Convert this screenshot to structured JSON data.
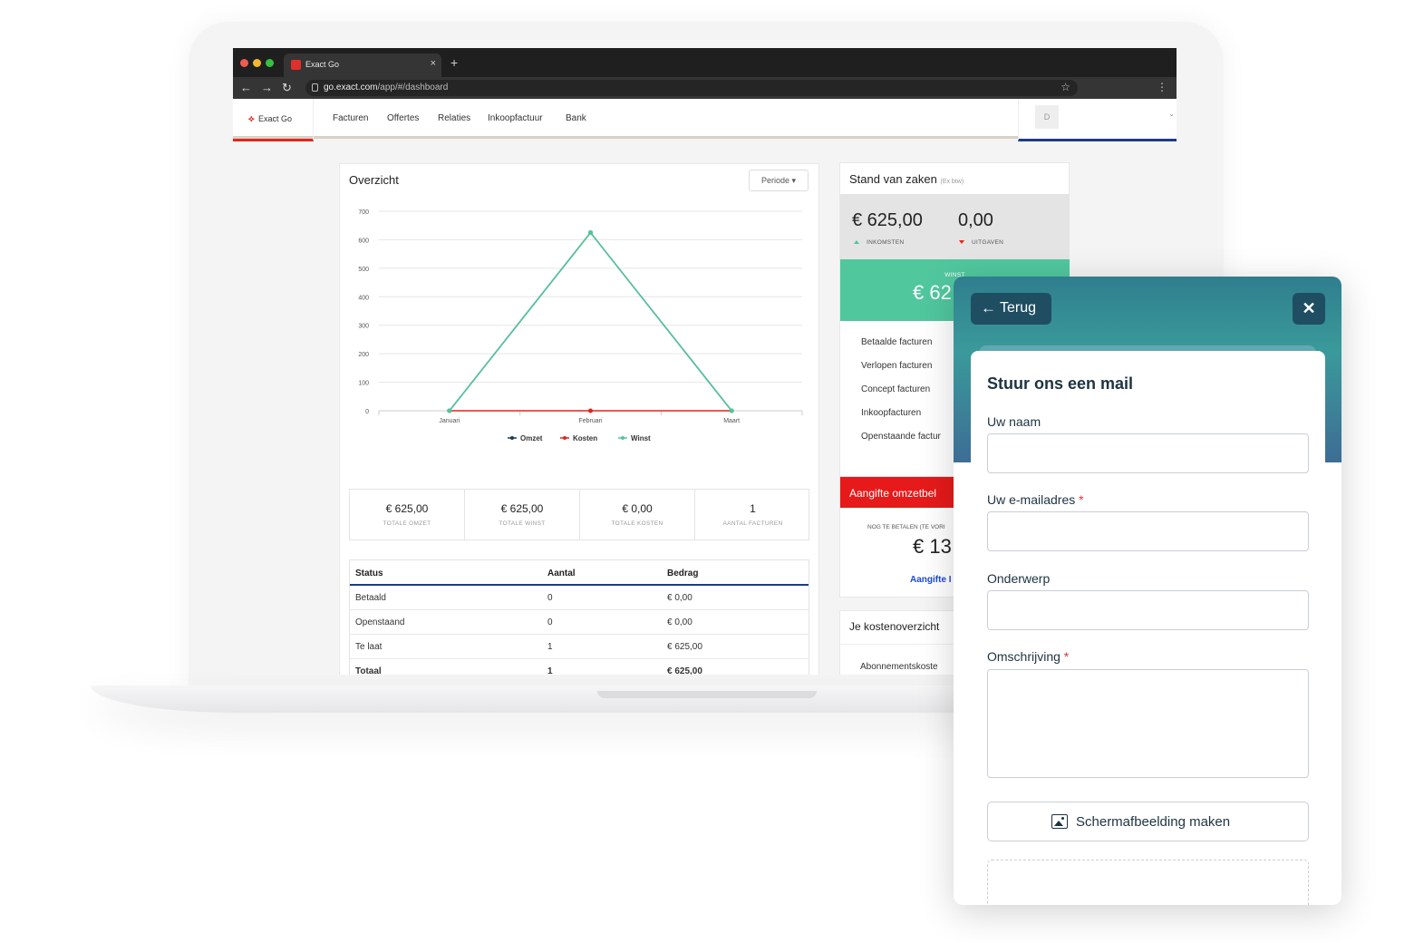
{
  "browser": {
    "tab_title": "Exact Go",
    "tab_close": "×",
    "new_tab": "+",
    "url_host": "go.exact.com",
    "url_path": "/app/#/dashboard"
  },
  "app": {
    "logo_text": "Exact Go",
    "nav": [
      "Facturen",
      "Offertes",
      "Relaties",
      "Inkoopfactuur",
      "Bank"
    ],
    "avatar_initial": "D"
  },
  "overview": {
    "title": "Overzicht",
    "periode_label": "Periode ▾"
  },
  "chart_data": {
    "type": "line",
    "categories": [
      "Januari",
      "Februari",
      "Maart"
    ],
    "series": [
      {
        "name": "Omzet",
        "color": "#1d3b4f",
        "values": [
          0,
          625,
          0
        ]
      },
      {
        "name": "Kosten",
        "color": "#e1251b",
        "values": [
          0,
          0,
          0
        ]
      },
      {
        "name": "Winst",
        "color": "#51c79e",
        "values": [
          0,
          625,
          0
        ]
      }
    ],
    "ylim": [
      0,
      700
    ],
    "yticks": [
      0,
      100,
      200,
      300,
      400,
      500,
      600,
      700
    ],
    "grid": true,
    "legend": "bottom"
  },
  "stats": [
    {
      "value": "€ 625,00",
      "label": "TOTALE OMZET"
    },
    {
      "value": "€ 625,00",
      "label": "TOTALE WINST"
    },
    {
      "value": "€ 0,00",
      "label": "TOTALE KOSTEN"
    },
    {
      "value": "1",
      "label": "AANTAL FACTUREN"
    }
  ],
  "status_table": {
    "headers": [
      "Status",
      "Aantal",
      "Bedrag"
    ],
    "rows": [
      [
        "Betaald",
        "0",
        "€ 0,00"
      ],
      [
        "Openstaand",
        "0",
        "€ 0,00"
      ],
      [
        "Te laat",
        "1",
        "€ 625,00"
      ],
      [
        "Totaal",
        "1",
        "€ 625,00"
      ]
    ]
  },
  "stand": {
    "title": "Stand van zaken",
    "title_note": "(Ex btw)",
    "inkomsten_value": "€ 625,00",
    "inkomsten_label": "INKOMSTEN",
    "uitgaven_value": "0,00",
    "uitgaven_label": "UITGAVEN",
    "winst_label": "WINST",
    "winst_value": "€ 62",
    "links": [
      "Betaalde facturen",
      "Verlopen facturen",
      "Concept facturen",
      "Inkoopfacturen",
      "Openstaande factur"
    ]
  },
  "aangifte": {
    "title": "Aangifte omzetbel",
    "sub": "NOG TE BETALEN (TE VORI",
    "value": "€ 13",
    "link": "Aangifte I"
  },
  "kosten": {
    "title": "Je kostenoverzicht",
    "item": "Abonnementskoste"
  },
  "widget": {
    "back_arrow": "←",
    "back_label": "Terug",
    "close_label": "✕",
    "form_title": "Stuur ons een mail",
    "name_label": "Uw naam",
    "email_label": "Uw e-mailadres",
    "subject_label": "Onderwerp",
    "description_label": "Omschrijving",
    "required_mark": "*",
    "screenshot_label": "Schermafbeelding maken"
  }
}
